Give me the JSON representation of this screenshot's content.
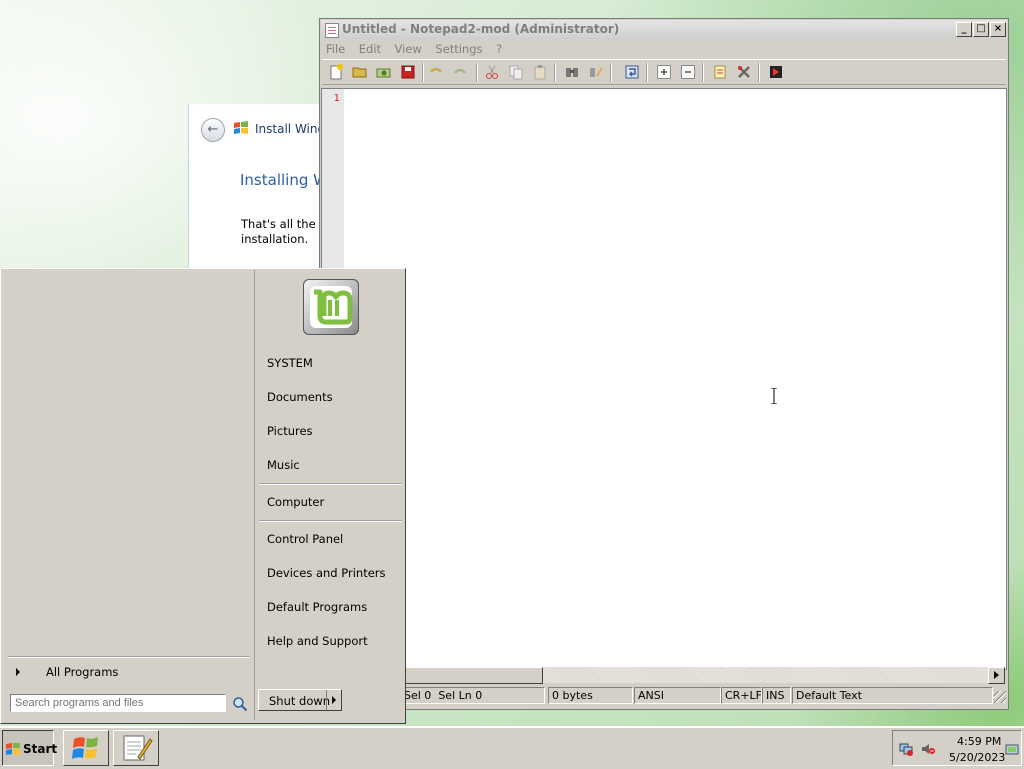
{
  "installer": {
    "title": "Install Wind",
    "heading": "Installing W",
    "body": "That's all the i installation."
  },
  "notepad": {
    "title": "Untitled - Notepad2-mod (Administrator)",
    "menu": [
      "File",
      "Edit",
      "View",
      "Settings",
      "?"
    ],
    "line_numbers": [
      "1"
    ],
    "status": {
      "sel": "Sel 0",
      "sel_ln": "Sel Ln 0",
      "bytes": "0 bytes",
      "encoding": "ANSI",
      "eol": "CR+LF",
      "mode": "INS",
      "scheme": "Default Text"
    },
    "toolbar_icons": [
      "new-icon",
      "open-icon",
      "browse-icon",
      "save-icon",
      "undo-icon",
      "redo-icon",
      "cut-icon",
      "copy-icon",
      "paste-icon",
      "find-icon",
      "replace-icon",
      "wordwrap-icon",
      "zoom-in-icon",
      "zoom-out-icon",
      "scheme-icon",
      "settings-icon",
      "exit-icon"
    ]
  },
  "startmenu": {
    "all_programs": "All Programs",
    "search_placeholder": "Search programs and files",
    "shutdown": "Shut down",
    "right_items": [
      "SYSTEM",
      "Documents",
      "Pictures",
      "Music",
      "Computer",
      "Control Panel",
      "Devices and Printers",
      "Default Programs",
      "Help and Support"
    ]
  },
  "taskbar": {
    "start_label": "Start",
    "time": "4:59 PM",
    "date": "5/20/2023"
  },
  "colors": {
    "line_number": "#d02020",
    "installer_heading": "#2d5ea8",
    "title_inactive": "#7f7f7f"
  }
}
